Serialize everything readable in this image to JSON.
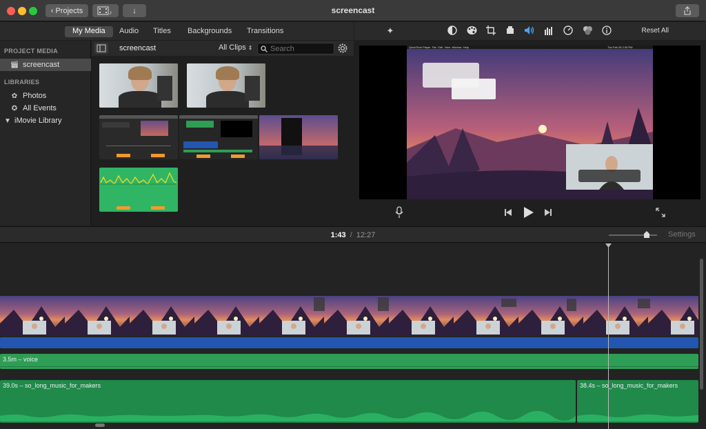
{
  "window": {
    "title": "screencast"
  },
  "toolbar": {
    "projects_label": "Projects"
  },
  "browser_tabs": [
    "My Media",
    "Audio",
    "Titles",
    "Backgrounds",
    "Transitions"
  ],
  "sidebar": {
    "project_media_heading": "PROJECT MEDIA",
    "project_item": "screencast",
    "libraries_heading": "LIBRARIES",
    "items": [
      {
        "label": "Photos",
        "icon": "photos-icon"
      },
      {
        "label": "All Events",
        "icon": "star-icon"
      },
      {
        "label": "iMovie Library",
        "icon": "disclosure-triangle-icon"
      }
    ]
  },
  "browser": {
    "event_name": "screencast",
    "filter": "All Clips",
    "search_placeholder": "Search"
  },
  "adjust": {
    "reset_label": "Reset All"
  },
  "preview_menubar": [
    "QuickTime Player",
    "File",
    "Edit",
    "View",
    "Window",
    "Help"
  ],
  "preview_clock": "Thu Feb 28  2:39 PM",
  "timeline": {
    "current_time": "1:43",
    "separator": "/",
    "total_time": "12:27",
    "settings_label": "Settings",
    "voice_clip": "3.5m – voice",
    "music_clip_1": "39.0s – so_long_music_for_makers",
    "music_clip_2": "38.4s – so_long_music_for_makers"
  },
  "colors": {
    "accent_blue": "#4aa3ff",
    "audio_green": "#2e9e55",
    "music_green": "#1f8a4a",
    "video_blue": "#2356b0"
  }
}
